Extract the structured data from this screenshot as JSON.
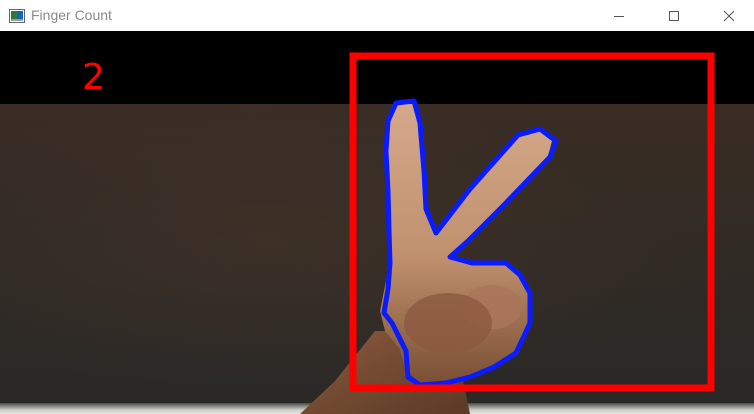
{
  "window": {
    "title": "Finger Count",
    "icon": "opencv-window-icon",
    "controls": {
      "minimize": "minimize-icon",
      "maximize": "maximize-icon",
      "close": "close-icon"
    }
  },
  "display": {
    "finger_count": "2"
  },
  "colors": {
    "count_text": "#ff0000",
    "roi_box": "#ff0000",
    "hand_contour": "#0a1cff"
  }
}
